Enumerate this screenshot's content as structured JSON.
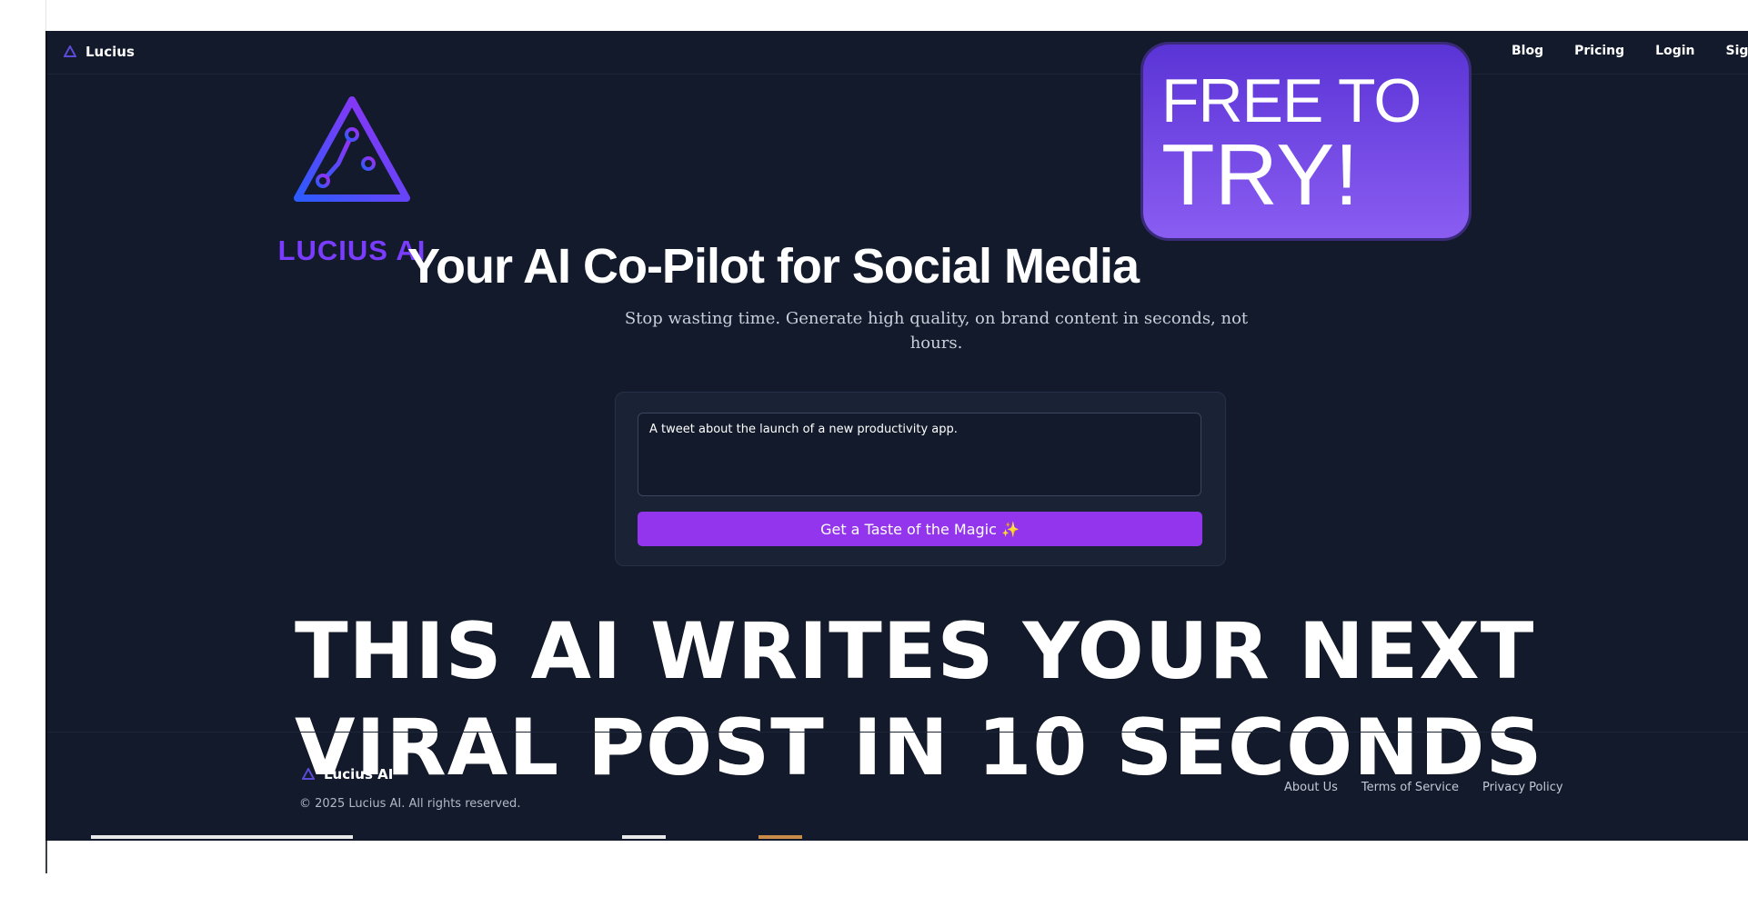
{
  "nav": {
    "brand": "Lucius",
    "links": [
      "Blog",
      "Pricing",
      "Login",
      "Sign"
    ]
  },
  "logo": {
    "text": "LUCIUS AI"
  },
  "badge": {
    "line1": "FREE TO",
    "line2": "TRY!"
  },
  "hero": {
    "title": "Your AI Co-Pilot for Social Media",
    "subtitle": "Stop wasting time. Generate high quality, on brand content in seconds, not hours."
  },
  "prompt": {
    "value": "A tweet about the launch of a new productivity app."
  },
  "cta": {
    "label": "Get a Taste of the Magic ✨"
  },
  "overlay": {
    "line1": "THIS AI WRITES YOUR NEXT",
    "line2": "VIRAL POST IN 10 SECONDS"
  },
  "footer": {
    "brand": "Lucius AI",
    "copyright": "© 2025 Lucius AI. All rights reserved.",
    "links": [
      "About Us",
      "Terms of Service",
      "Privacy Policy"
    ]
  },
  "colors": {
    "background": "#121a2c",
    "accent": "#9335ec",
    "badge": "#6a45e0"
  }
}
